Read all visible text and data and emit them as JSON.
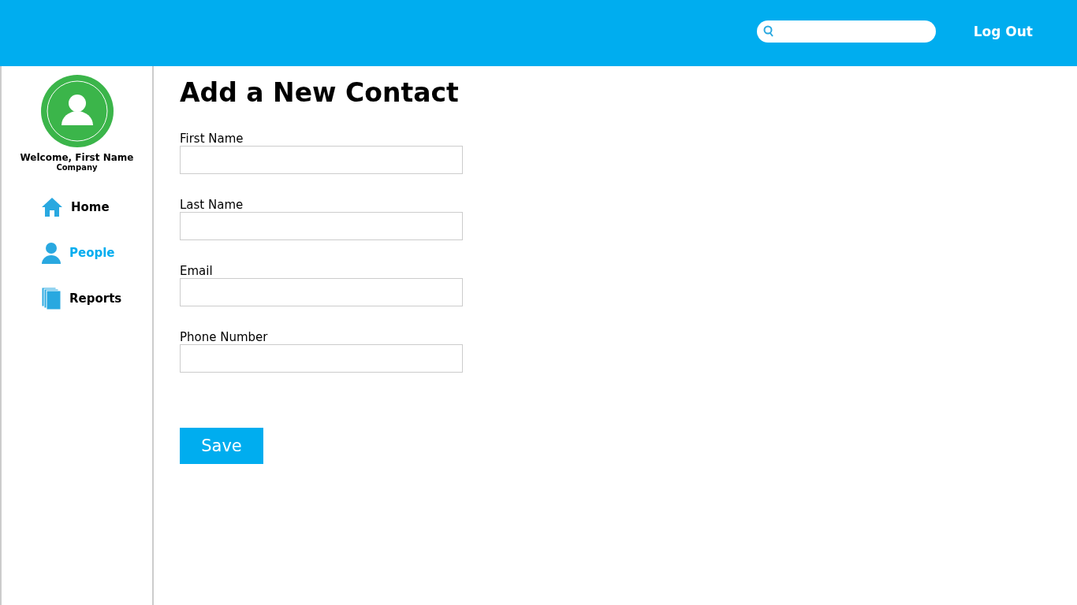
{
  "header": {
    "logout": "Log Out"
  },
  "sidebar": {
    "welcome": "Welcome, First Name",
    "company": "Company",
    "items": [
      {
        "label": "Home",
        "kind": "home",
        "selected": false
      },
      {
        "label": "People",
        "kind": "person",
        "selected": true
      },
      {
        "label": "Reports",
        "kind": "pages",
        "selected": false
      }
    ]
  },
  "page_title": "Add a New Contact",
  "fields": [
    {
      "label": "First Name"
    },
    {
      "label": "Last Name"
    },
    {
      "label": "Email"
    },
    {
      "label": "Phone Number"
    }
  ],
  "save_button": "Save"
}
